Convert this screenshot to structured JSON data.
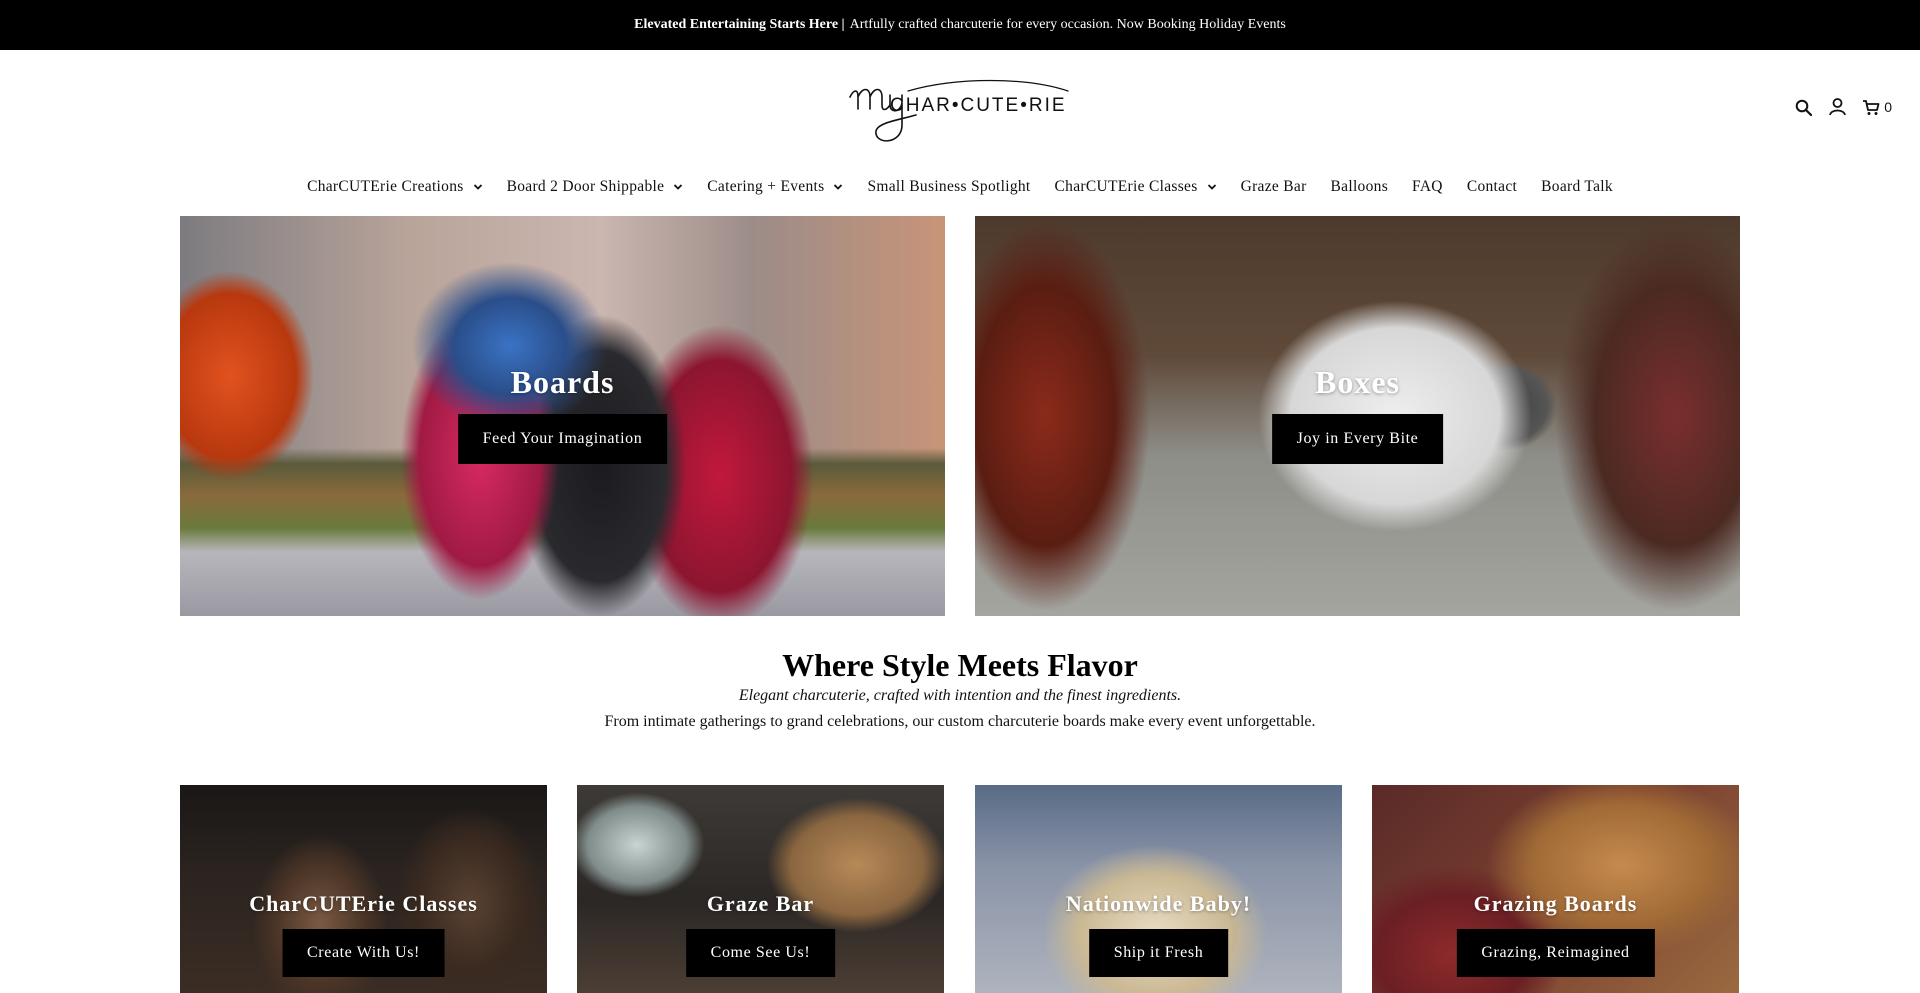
{
  "announcement": {
    "bold": "Elevated Entertaining Starts Here |",
    "text": "Artfully crafted charcuterie for every occasion. Now Booking Holiday Events"
  },
  "header": {
    "logo_text": "my CHAR•CUTE•RIE",
    "cart_count": "0",
    "icons": [
      "search-icon",
      "account-icon",
      "cart-icon"
    ]
  },
  "nav": {
    "items": [
      {
        "label": "CharCUTErie Creations",
        "has_dropdown": true
      },
      {
        "label": "Board 2 Door Shippable",
        "has_dropdown": true
      },
      {
        "label": "Catering + Events",
        "has_dropdown": true
      },
      {
        "label": "Small Business Spotlight",
        "has_dropdown": false
      },
      {
        "label": "CharCUTErie Classes",
        "has_dropdown": true
      },
      {
        "label": "Graze Bar",
        "has_dropdown": false
      },
      {
        "label": "Balloons",
        "has_dropdown": false
      },
      {
        "label": "FAQ",
        "has_dropdown": false
      },
      {
        "label": "Contact",
        "has_dropdown": false
      },
      {
        "label": "Board Talk",
        "has_dropdown": false
      }
    ]
  },
  "hero": [
    {
      "title": "Boards",
      "button": "Feed Your Imagination"
    },
    {
      "title": "Boxes",
      "button": "Joy in Every Bite"
    }
  ],
  "intro": {
    "heading": "Where Style Meets Flavor",
    "tagline": "Elegant charcuterie, crafted with intention and the finest ingredients.",
    "description": "From intimate gatherings to grand celebrations, our custom charcuterie boards make every event unforgettable."
  },
  "promos": [
    {
      "title": "CharCUTErie Classes",
      "button": "Create With Us!"
    },
    {
      "title": "Graze Bar",
      "button": "Come See Us!"
    },
    {
      "title": "Nationwide Baby!",
      "button": "Ship it Fresh"
    },
    {
      "title": "Grazing Boards",
      "button": "Grazing, Reimagined"
    }
  ]
}
